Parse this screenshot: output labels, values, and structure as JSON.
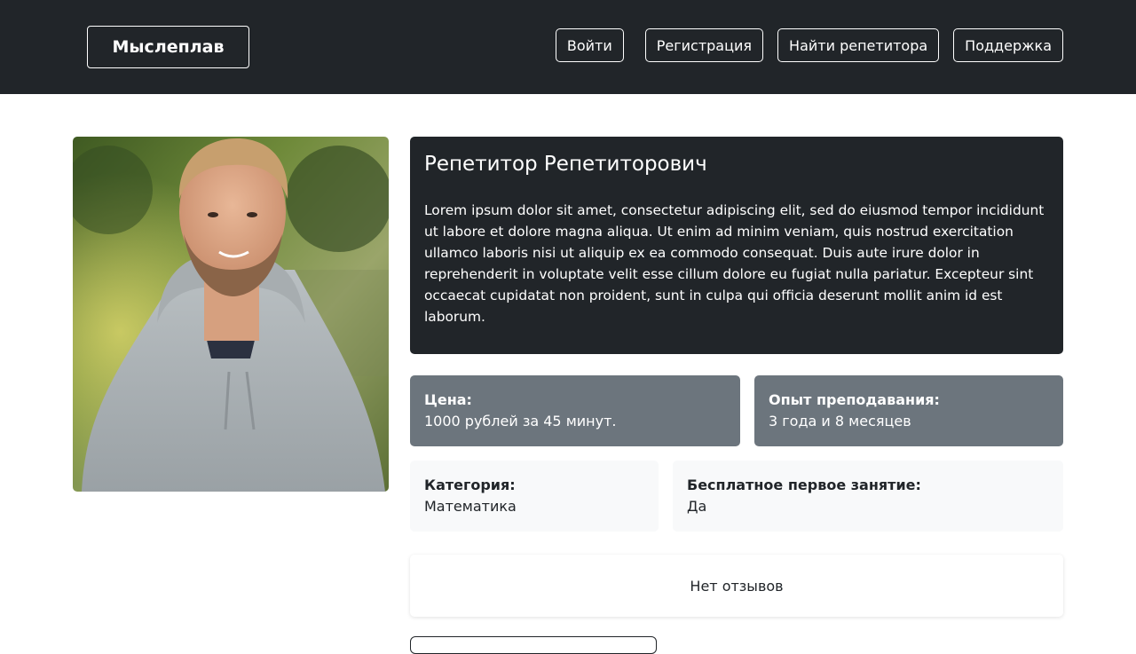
{
  "navbar": {
    "brand": "Мыслеплав",
    "links": [
      "Войти",
      "Регистрация",
      "Найти репетитора",
      "Поддержка"
    ]
  },
  "tutor": {
    "name": "Репетитор Репетиторович",
    "description": "Lorem ipsum dolor sit amet, consectetur adipiscing elit, sed do eiusmod tempor incididunt ut labore et dolore magna aliqua. Ut enim ad minim veniam, quis nostrud exercitation ullamco laboris nisi ut aliquip ex ea commodo consequat. Duis aute irure dolor in reprehenderit in voluptate velit esse cillum dolore eu fugiat nulla pariatur. Excepteur sint occaecat cupidatat non proident, sunt in culpa qui officia deserunt mollit anim id est laborum."
  },
  "stats": {
    "price": {
      "label": "Цена:",
      "value": "1000 рублей за 45 минут."
    },
    "experience": {
      "label": "Опыт преподавания:",
      "value": "3 года и 8 месяцев"
    },
    "category": {
      "label": "Категория:",
      "value": "Математика"
    },
    "free_lesson": {
      "label": "Бесплатное первое занятие:",
      "value": "Да"
    }
  },
  "reviews": {
    "empty_text": "Нет отзывов"
  },
  "colors": {
    "navbar_bg": "#212529",
    "card_dark": "#212529",
    "card_gray": "#6c757d",
    "card_light": "#f8f9fa"
  }
}
